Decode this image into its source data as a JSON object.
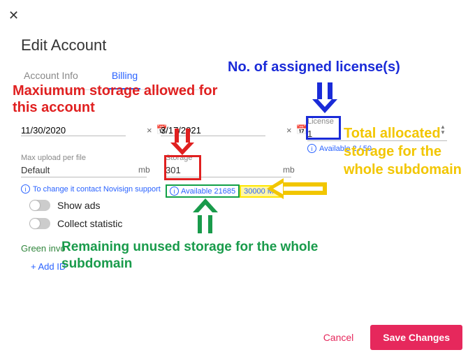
{
  "title": "Edit Account",
  "tabs": {
    "info": "Account Info",
    "billing": "Billing"
  },
  "dates": {
    "d1": "11/30/2020",
    "d2": "3/17/2021"
  },
  "license": {
    "label": "License",
    "value": "1",
    "avail": "Available 2 / 50"
  },
  "maxupload": {
    "label": "Max upload per file",
    "value": "Default",
    "unit": "mb"
  },
  "storage": {
    "label": "Storage",
    "value": "301",
    "unit": "mb",
    "avail": "Available 21685",
    "total": "30000 MB"
  },
  "support_note": "To change it contact Novisign support",
  "toggles": {
    "ads": "Show ads",
    "stats": "Collect statistic"
  },
  "green_inv": "Green invo",
  "add_id": "+  Add ID",
  "footer": {
    "cancel": "Cancel",
    "save": "Save Changes"
  },
  "anno": {
    "red": "Maxiumum storage allowed for this account",
    "blue": "No. of assigned license(s)",
    "yellow": "Total allocated storage for the whole subdomain",
    "green": "Remaining unused storage for the whole subdomain"
  }
}
